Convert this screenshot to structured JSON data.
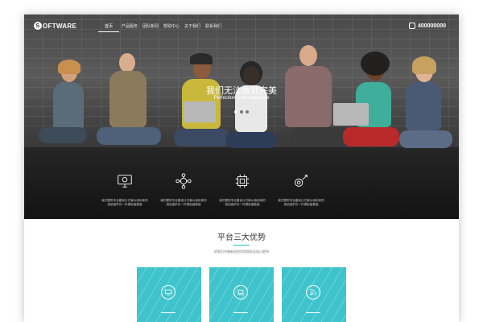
{
  "brand": {
    "logo_letter": "S",
    "logo_text": "OFTWARE"
  },
  "nav": {
    "items": [
      {
        "label": "首页",
        "active": true
      },
      {
        "label": "产品服务",
        "active": false
      },
      {
        "label": "团队新闻",
        "active": false
      },
      {
        "label": "帮助中心",
        "active": false
      },
      {
        "label": "关于我们",
        "active": false
      },
      {
        "label": "联系我们",
        "active": false
      }
    ],
    "phone": "400000000"
  },
  "hero": {
    "title": "我们无法做到完美",
    "subtitle": "Perfection isnot attainable",
    "slides": 3,
    "active_slide": 1
  },
  "features": [
    {
      "icon": "monitor-gear-icon",
      "text_line1": "我们提供专业建设计方案以用优体的",
      "text_line2": "成站维护办一件提权量数组"
    },
    {
      "icon": "network-nodes-icon",
      "text_line1": "我们提供专业建设计方案以用优体的",
      "text_line2": "成站维护办一件提权量数组"
    },
    {
      "icon": "chip-icon",
      "text_line1": "我们提供专业建设计方案以用优体的",
      "text_line2": "成站维护办一件提权量数组"
    },
    {
      "icon": "rocket-gear-icon",
      "text_line1": "我们提供专业建设计方案以用优体的",
      "text_line2": "成站维护办一件提权量数组"
    }
  ],
  "advantages": {
    "title": "平台三大优势",
    "subtitle": "的帮们共期新造的用您相所实现以更则",
    "accent": "#29b8c6",
    "cards": [
      {
        "icon": "monitor-icon"
      },
      {
        "icon": "laptop-icon"
      },
      {
        "icon": "rss-icon"
      }
    ]
  }
}
